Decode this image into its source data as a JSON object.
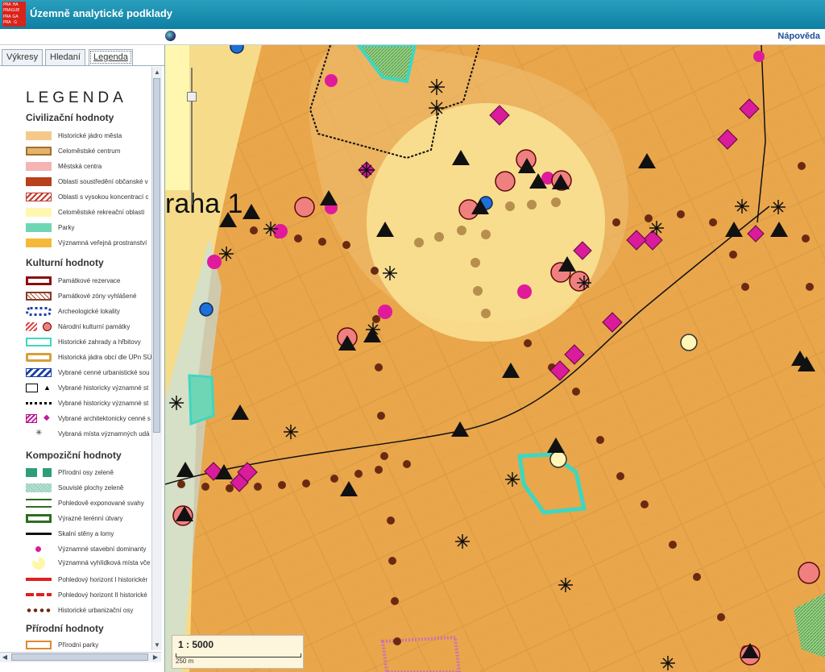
{
  "app": {
    "title": "Územně analytické podklady",
    "logo_letters": [
      "PRA",
      "HA",
      "",
      "PRA",
      "GUE",
      "",
      "PRA",
      "GA",
      "",
      "PRA",
      "G",
      ""
    ]
  },
  "toolbar": {
    "help_label": "Nápověda",
    "globe_icon": "globe-icon"
  },
  "tabs": [
    {
      "label": "Výkresy",
      "active": false
    },
    {
      "label": "Hledaní",
      "active": false
    },
    {
      "label": "Legenda",
      "active": true
    }
  ],
  "legend": {
    "title": "LEGENDA",
    "sections": [
      {
        "name": "Civilizační hodnoty"
      },
      {
        "name": "Kulturní hodnoty"
      },
      {
        "name": "Kompoziční hodnoty"
      },
      {
        "name": "Přírodní hodnoty"
      }
    ],
    "items": [
      {
        "label": "Historické jádro města"
      },
      {
        "label": "Celoměstské centrum"
      },
      {
        "label": "Městská centra"
      },
      {
        "label": "Oblasti soustředění občanské v"
      },
      {
        "label": "Oblasti s vysokou koncentrací c"
      },
      {
        "label": "Celoměstské rekreační oblasti"
      },
      {
        "label": "Parky"
      },
      {
        "label": "Významná veřejná prostranství"
      },
      {
        "label": "Památkové rezervace"
      },
      {
        "label": "Památkové zóny vyhlášené"
      },
      {
        "label": "Archeologické lokality"
      },
      {
        "label": "Národní kulturní památky"
      },
      {
        "label": "Historické zahrady a hřbitovy"
      },
      {
        "label": "Historická jádra obcí dle ÚPn SÚ"
      },
      {
        "label": "Vybrané cenné urbanistické sou"
      },
      {
        "label": "Vybrané historicky významné st"
      },
      {
        "label": "Vybrané historicky významné st"
      },
      {
        "label": "Vybrané architektonicky cenné s"
      },
      {
        "label": "Vybraná místa významných udá"
      },
      {
        "label": "Přírodní osy zeleně"
      },
      {
        "label": "Souvislé plochy zeleně"
      },
      {
        "label": "Pohledově exponované svahy"
      },
      {
        "label": "Výrazné terénní útvary"
      },
      {
        "label": "Skalní stěny a lomy"
      },
      {
        "label": "Významné stavební dominanty"
      },
      {
        "label": "Významná vyhlídková místa vče"
      },
      {
        "label": "Pohledový horizont I historickér"
      },
      {
        "label": "Pohledový horizont II historické"
      },
      {
        "label": "Historické urbanizační osy"
      },
      {
        "label": "Přírodní parky"
      }
    ]
  },
  "map": {
    "district_label": "raha 1",
    "scale_text": "1 : 5000",
    "scale_distance": "250 m"
  }
}
